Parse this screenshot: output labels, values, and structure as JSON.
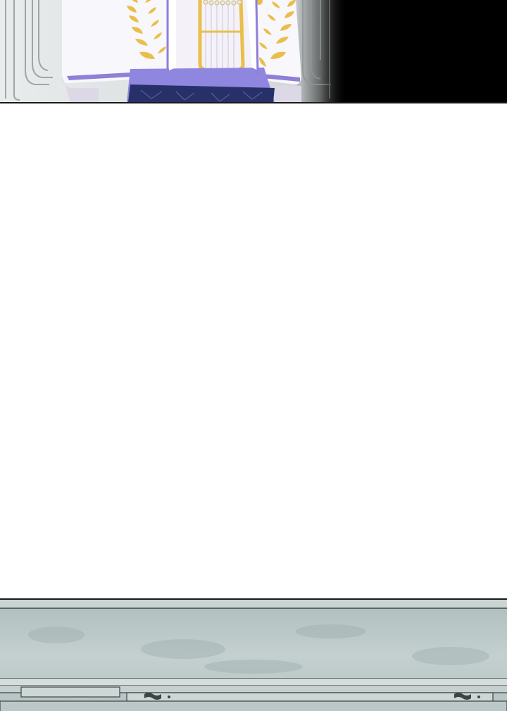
{
  "comic": {
    "panels": [
      {
        "id": "top",
        "scene": "figure-in-white-robe"
      },
      {
        "id": "bottom",
        "scene": "stone-ceiling"
      }
    ]
  },
  "colors": {
    "robe_white": "#f8f7fb",
    "robe_shadow": "#dcd8e6",
    "trim_purple": "#8f7fd6",
    "sash_purple": "#8f86e0",
    "laurel_gold": "#e9be4a",
    "pants_navy": "#28306a",
    "background_black": "#000000",
    "stone_gray": "#b9c7c6",
    "stone_dark": "#7f8f8f"
  }
}
